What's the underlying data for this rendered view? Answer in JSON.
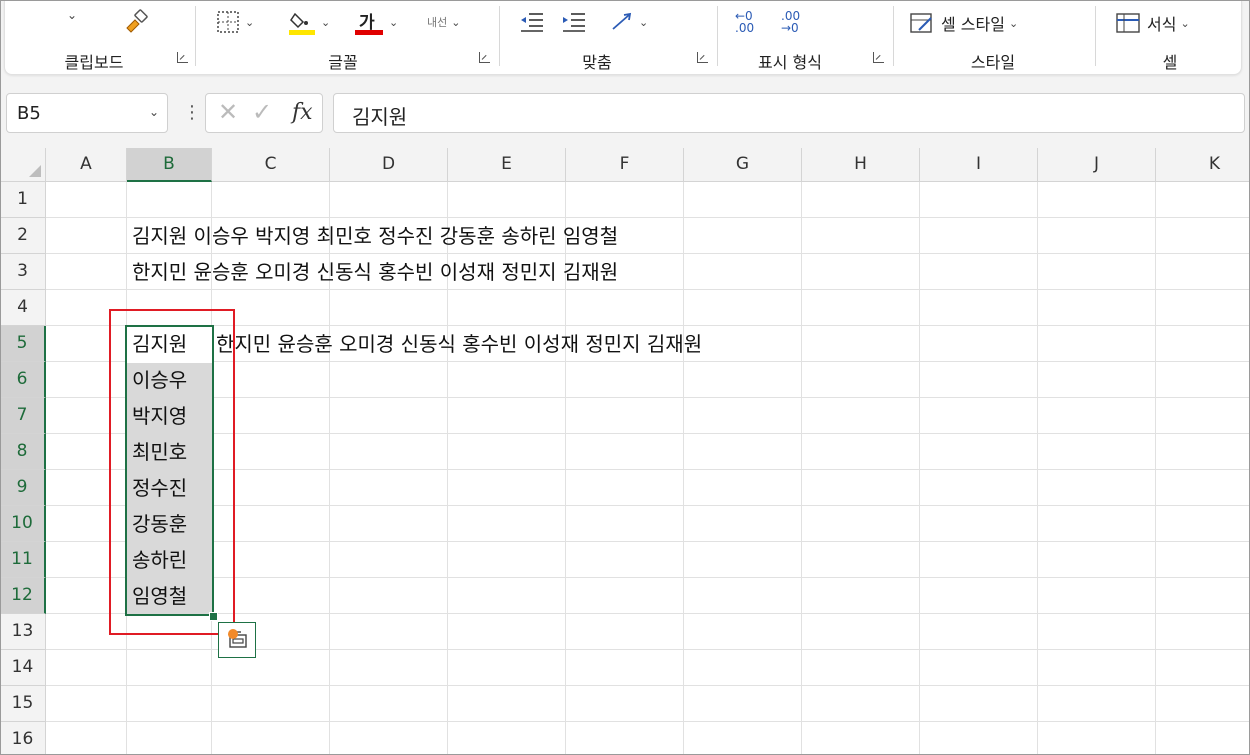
{
  "ribbon": {
    "groups": [
      {
        "label": "클립보드"
      },
      {
        "label": "글꼴"
      },
      {
        "label": "맞춤"
      },
      {
        "label": "표시 형식"
      },
      {
        "label": "스타일"
      },
      {
        "label": "셀"
      }
    ],
    "font_color_glyph": "가",
    "wrap_glyph": "내선",
    "decimal_increase": "←0 .00",
    "decimal_decrease": ".00 →0",
    "cell_style_label": "셀 스타일",
    "format_label": "서식"
  },
  "formula_bar": {
    "name_box": "B5",
    "fx_label": "fx",
    "formula": "김지원"
  },
  "sheet": {
    "columns": [
      "A",
      "B",
      "C",
      "D",
      "E",
      "F",
      "G",
      "H",
      "I",
      "J",
      "K"
    ],
    "rows": [
      "1",
      "2",
      "3",
      "4",
      "5",
      "6",
      "7",
      "8",
      "9",
      "10",
      "11",
      "12",
      "13",
      "14",
      "15",
      "16"
    ],
    "selected_column": "B",
    "selected_rows": [
      "5",
      "6",
      "7",
      "8",
      "9",
      "10",
      "11",
      "12"
    ],
    "row2_text": "김지원 이승우 박지영 최민호 정수진 강동훈 송하린 임영철",
    "row3_text": "한지민 윤승훈 오미경 신동식 홍수빈 이성재 정민지 김재원",
    "b5": "김지원",
    "c5_text": "한지민 윤승훈 오미경 신동식 홍수빈 이성재 정민지 김재원",
    "b_column": [
      "이승우",
      "박지영",
      "최민호",
      "정수진",
      "강동훈",
      "송하린",
      "임영철"
    ]
  },
  "colors": {
    "accent_green": "#1e7145",
    "highlight_red": "#e01b24",
    "font_color_red": "#e00000",
    "fill_yellow": "#ffe600"
  }
}
